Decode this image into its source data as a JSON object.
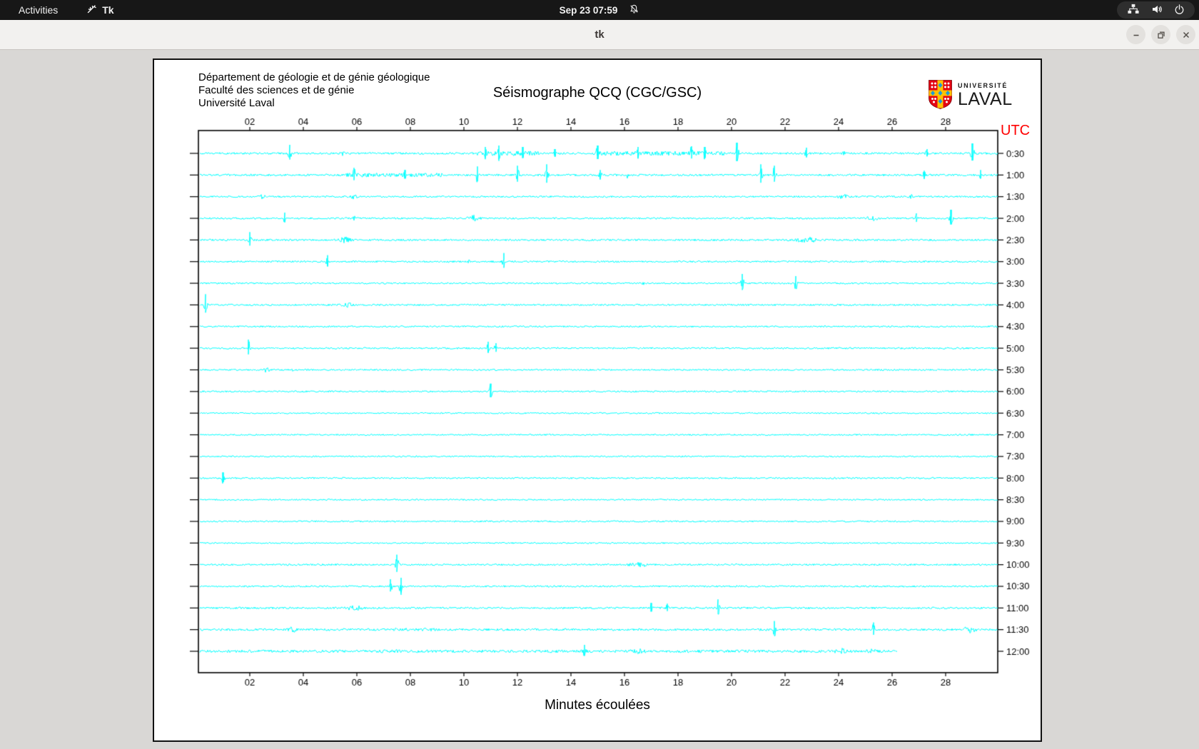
{
  "topbar": {
    "activities_label": "Activities",
    "app_label": "Tk",
    "clock": "Sep 23  07:59"
  },
  "titlebar": {
    "title": "tk"
  },
  "panel": {
    "header_lines": [
      "Département de géologie et de génie géologique",
      "Faculté des sciences et de génie",
      "Université Laval"
    ],
    "logo": {
      "line1": "UNIVERSITÉ",
      "line2": "LAVAL"
    }
  },
  "colors": {
    "trace": "#00ffff",
    "utc_red": "#ff0000",
    "logo_red": "#e30513",
    "logo_yellow": "#ffc103",
    "logo_blue": "#1f9bd7",
    "frame": "#000000"
  },
  "chart_data": {
    "type": "line",
    "title": "Séismographe QCQ (CGC/GSC)",
    "xlabel": "Minutes écoulées",
    "utc_label": "UTC",
    "x_range": [
      0,
      30
    ],
    "x_ticks": [
      "02",
      "04",
      "06",
      "08",
      "10",
      "12",
      "14",
      "16",
      "18",
      "20",
      "22",
      "24",
      "26",
      "28"
    ],
    "trace_color": "#00ffff",
    "rows": [
      {
        "label": "0:30",
        "end": 29.95,
        "base": 1.4,
        "bursts": [
          [
            10.5,
            12.8,
            3.2
          ],
          [
            14.8,
            19.8,
            3.0
          ]
        ],
        "events": [
          [
            3.5,
            12
          ],
          [
            5.5,
            5
          ],
          [
            9.0,
            4
          ],
          [
            10.8,
            9
          ],
          [
            11.3,
            11
          ],
          [
            12.2,
            9
          ],
          [
            13.4,
            6
          ],
          [
            15.0,
            11
          ],
          [
            16.5,
            9
          ],
          [
            18.5,
            10
          ],
          [
            19.0,
            9
          ],
          [
            20.2,
            15
          ],
          [
            22.8,
            8
          ],
          [
            24.2,
            4
          ],
          [
            27.3,
            6
          ],
          [
            29.0,
            14
          ]
        ]
      },
      {
        "label": "1:00",
        "end": 29.95,
        "base": 1.4,
        "bursts": [
          [
            5.6,
            9.2,
            2.8
          ]
        ],
        "events": [
          [
            5.9,
            10
          ],
          [
            7.8,
            7
          ],
          [
            10.5,
            12
          ],
          [
            12.0,
            13
          ],
          [
            13.1,
            15
          ],
          [
            15.1,
            7
          ],
          [
            16.1,
            5
          ],
          [
            21.1,
            15
          ],
          [
            21.6,
            13
          ],
          [
            27.2,
            6
          ],
          [
            29.3,
            7
          ]
        ]
      },
      {
        "label": "1:30",
        "end": 29.95,
        "base": 1.2,
        "bursts": [],
        "events": [
          [
            2.5,
            4,
            0.15
          ],
          [
            5.9,
            4,
            0.1
          ],
          [
            24.2,
            4,
            0.2
          ],
          [
            26.7,
            5
          ]
        ]
      },
      {
        "label": "2:00",
        "end": 29.95,
        "base": 1.2,
        "bursts": [],
        "events": [
          [
            3.3,
            8
          ],
          [
            5.9,
            4
          ],
          [
            10.4,
            5,
            0.2
          ],
          [
            25.2,
            4,
            0.25
          ],
          [
            26.9,
            7
          ],
          [
            28.2,
            12
          ]
        ]
      },
      {
        "label": "2:30",
        "end": 29.95,
        "base": 1.3,
        "bursts": [],
        "events": [
          [
            2.0,
            11
          ],
          [
            5.6,
            5,
            0.2
          ],
          [
            22.8,
            5,
            0.3
          ]
        ]
      },
      {
        "label": "3:00",
        "end": 29.95,
        "base": 1.2,
        "bursts": [],
        "events": [
          [
            4.9,
            9
          ],
          [
            10.2,
            3
          ],
          [
            11.5,
            12
          ]
        ]
      },
      {
        "label": "3:30",
        "end": 29.95,
        "base": 1.1,
        "bursts": [],
        "events": [
          [
            16.7,
            3
          ],
          [
            20.4,
            13
          ],
          [
            22.4,
            10
          ]
        ]
      },
      {
        "label": "4:00",
        "end": 29.95,
        "base": 1.2,
        "bursts": [],
        "events": [
          [
            0.35,
            15
          ],
          [
            5.6,
            4,
            0.2
          ]
        ]
      },
      {
        "label": "4:30",
        "end": 29.95,
        "base": 1.1,
        "bursts": [],
        "events": [
          [
            10.0,
            3
          ]
        ]
      },
      {
        "label": "5:00",
        "end": 29.95,
        "base": 1.2,
        "bursts": [],
        "events": [
          [
            1.95,
            12
          ],
          [
            7.3,
            3
          ],
          [
            10.9,
            9
          ],
          [
            11.2,
            7
          ]
        ]
      },
      {
        "label": "5:30",
        "end": 29.95,
        "base": 1.1,
        "bursts": [],
        "events": [
          [
            2.6,
            4,
            0.12
          ],
          [
            3.6,
            3
          ]
        ]
      },
      {
        "label": "6:00",
        "end": 29.95,
        "base": 1.1,
        "bursts": [],
        "events": [
          [
            11.0,
            11
          ]
        ]
      },
      {
        "label": "6:30",
        "end": 29.95,
        "base": 1.0,
        "bursts": [],
        "events": []
      },
      {
        "label": "7:00",
        "end": 29.95,
        "base": 1.0,
        "bursts": [],
        "events": []
      },
      {
        "label": "7:30",
        "end": 29.95,
        "base": 1.0,
        "bursts": [],
        "events": []
      },
      {
        "label": "8:00",
        "end": 29.95,
        "base": 1.1,
        "bursts": [],
        "events": [
          [
            1.0,
            8
          ]
        ]
      },
      {
        "label": "8:30",
        "end": 29.95,
        "base": 1.0,
        "bursts": [],
        "events": []
      },
      {
        "label": "9:00",
        "end": 29.95,
        "base": 1.1,
        "bursts": [],
        "events": []
      },
      {
        "label": "9:30",
        "end": 29.95,
        "base": 1.0,
        "bursts": [],
        "events": []
      },
      {
        "label": "10:00",
        "end": 29.95,
        "base": 1.2,
        "bursts": [],
        "events": [
          [
            7.5,
            14
          ],
          [
            16.5,
            4,
            0.3
          ]
        ]
      },
      {
        "label": "10:30",
        "end": 29.95,
        "base": 1.2,
        "bursts": [],
        "events": [
          [
            7.25,
            10
          ],
          [
            7.65,
            12
          ]
        ]
      },
      {
        "label": "11:00",
        "end": 29.95,
        "base": 1.3,
        "bursts": [],
        "events": [
          [
            5.9,
            4,
            0.3
          ],
          [
            17.0,
            7
          ],
          [
            17.6,
            6
          ],
          [
            19.5,
            12
          ]
        ]
      },
      {
        "label": "11:30",
        "end": 29.95,
        "base": 1.5,
        "bursts": [
          [
            7.3,
            9.0,
            2.2
          ]
        ],
        "events": [
          [
            3.6,
            5,
            0.15
          ],
          [
            21.6,
            12
          ],
          [
            25.3,
            10
          ],
          [
            28.9,
            5,
            0.2
          ]
        ]
      },
      {
        "label": "12:00",
        "end": 26.2,
        "base": 1.9,
        "bursts": [
          [
            6.8,
            7.6,
            2.4
          ]
        ],
        "events": [
          [
            14.5,
            9
          ],
          [
            16.5,
            4,
            0.25
          ],
          [
            24.1,
            5,
            0.2
          ],
          [
            25.2,
            4,
            0.2
          ]
        ]
      }
    ]
  }
}
